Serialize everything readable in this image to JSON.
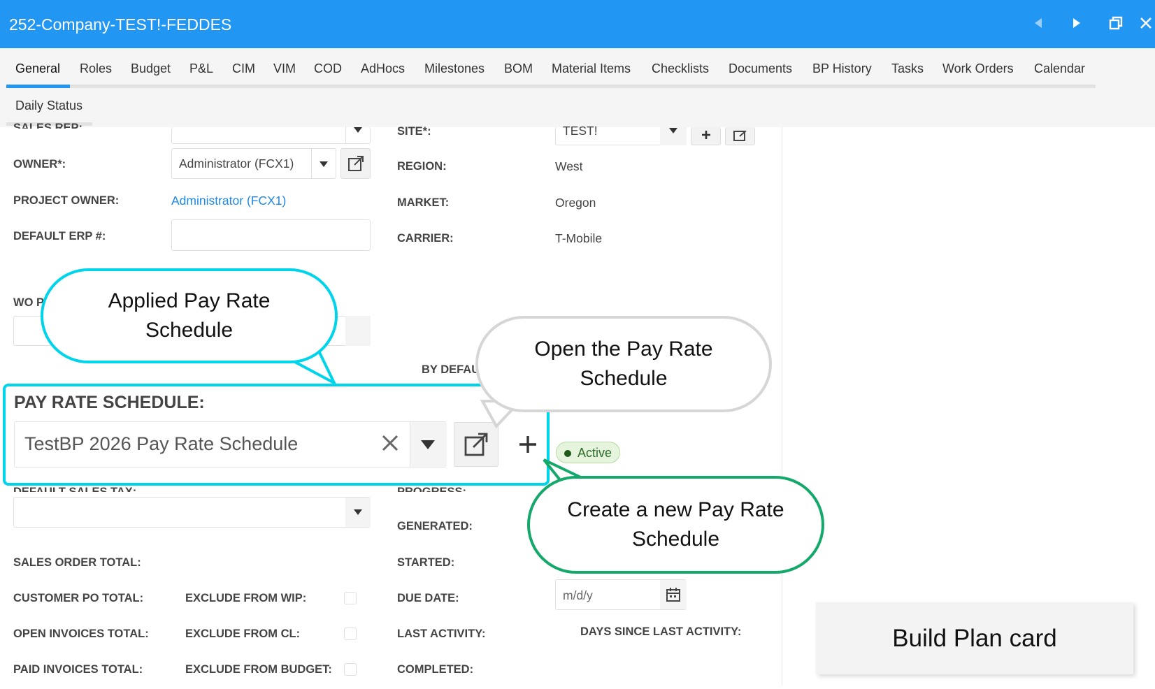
{
  "window": {
    "title": "252-Company-TEST!-FEDDES"
  },
  "tabs": {
    "row1": [
      "General",
      "Roles",
      "Budget",
      "P&L",
      "CIM",
      "VIM",
      "COD",
      "AdHocs",
      "Milestones",
      "BOM",
      "Material Items",
      "Checklists",
      "Documents",
      "BP History",
      "Tasks",
      "Work Orders",
      "Calendar"
    ],
    "row2": [
      "Daily Status"
    ],
    "active": "General"
  },
  "form": {
    "sales_rep_label": "SALES REP:",
    "owner_label": "OWNER*:",
    "owner_value": "Administrator (FCX1)",
    "project_owner_label": "PROJECT OWNER:",
    "project_owner_value": "Administrator (FCX1)",
    "default_erp_label": "DEFAULT ERP #:",
    "wo_label": "WO P",
    "site_label": "SITE*:",
    "site_value": "TEST!",
    "region_label": "REGION:",
    "region_value": "West",
    "market_label": "MARKET:",
    "market_value": "Oregon",
    "carrier_label": "CARRIER:",
    "carrier_value": "T-Mobile",
    "by_default_label": "BY DEFAU",
    "pay_rate_label": "PAY RATE SCHEDULE:",
    "pay_rate_value": "TestBP 2026 Pay Rate Schedule",
    "status_badge": "Active",
    "default_sales_tax_label": "DEFAULT SALES TAX:",
    "progress_label": "PROGRESS:",
    "generated_label": "GENERATED:",
    "sales_order_total_label": "SALES ORDER TOTAL:",
    "started_label": "STARTED:",
    "customer_po_total_label": "CUSTOMER PO TOTAL:",
    "exclude_wip_label": "EXCLUDE FROM WIP:",
    "due_date_label": "DUE DATE:",
    "due_date_placeholder": "m/d/y",
    "open_invoices_label": "OPEN INVOICES TOTAL:",
    "exclude_cl_label": "EXCLUDE FROM CL:",
    "last_activity_label": "LAST ACTIVITY:",
    "days_since_label": "DAYS SINCE LAST ACTIVITY:",
    "paid_invoices_label": "PAID INVOICES TOTAL:",
    "exclude_budget_label": "EXCLUDE FROM BUDGET:",
    "completed_label": "COMPLETED:"
  },
  "callouts": {
    "applied": "Applied Pay Rate Schedule",
    "open": "Open the Pay Rate Schedule",
    "create": "Create a new Pay Rate Schedule"
  },
  "build_plan_card": "Build Plan card",
  "colors": {
    "titlebar": "#2196f3",
    "callout_cyan": "#00d4ea",
    "callout_grey": "#d6d6d6",
    "callout_green": "#14a86a",
    "badge_bg": "#e6f4dd",
    "badge_text": "#2e6b26"
  }
}
